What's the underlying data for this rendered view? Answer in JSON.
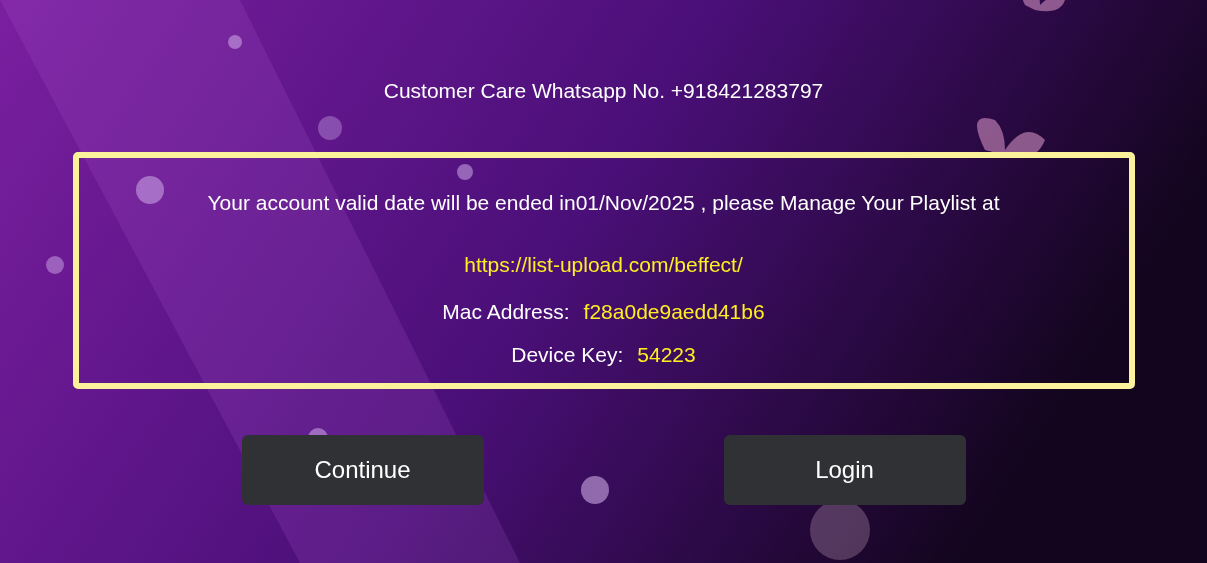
{
  "contact": {
    "text": "Customer Care Whatsapp No. +918421283797"
  },
  "notice": {
    "message": "Your account valid date will be ended in01/Nov/2025 , please Manage Your Playlist at",
    "link": "https://list-upload.com/beffect/",
    "fields": [
      {
        "label": "Mac Address:",
        "value": "f28a0de9aedd41b6"
      },
      {
        "label": "Device Key:",
        "value": "54223"
      }
    ]
  },
  "buttons": [
    {
      "label": "Continue"
    },
    {
      "label": "Login"
    }
  ]
}
